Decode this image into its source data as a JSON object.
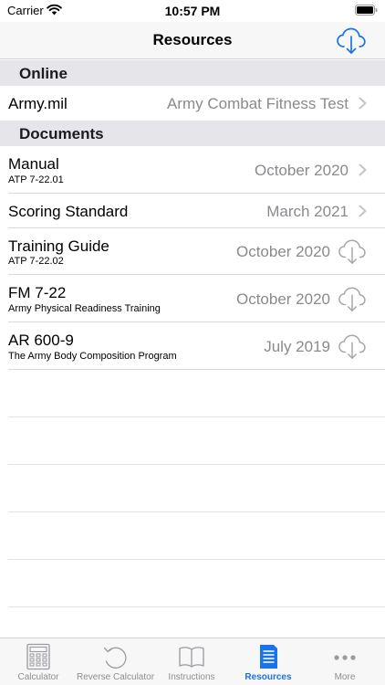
{
  "status": {
    "carrier": "Carrier",
    "time": "10:57 PM"
  },
  "nav": {
    "title": "Resources",
    "icon": "cloud-download-icon",
    "accent": "#1a73e8"
  },
  "sections": {
    "online": {
      "header": "Online",
      "rows": [
        {
          "title": "Army.mil",
          "value": "Army Combat Fitness Test",
          "accessory": "chevron"
        }
      ]
    },
    "documents": {
      "header": "Documents",
      "rows": [
        {
          "title": "Manual",
          "subtitle": "ATP 7-22.01",
          "value": "October 2020",
          "accessory": "chevron"
        },
        {
          "title": "Scoring Standard",
          "value": "March 2021",
          "accessory": "chevron"
        },
        {
          "title": "Training Guide",
          "subtitle": "ATP 7-22.02",
          "value": "October 2020",
          "accessory": "cloud-download"
        },
        {
          "title": "FM 7-22",
          "subtitle": "Army Physical Readiness Training",
          "value": "October 2020",
          "accessory": "cloud-download"
        },
        {
          "title": "AR 600-9",
          "subtitle": "The Army Body Composition Program",
          "value": "July 2019",
          "accessory": "cloud-download"
        }
      ]
    }
  },
  "tabs": [
    {
      "label": "Calculator",
      "icon": "calculator-icon"
    },
    {
      "label": "Reverse Calculator",
      "icon": "reverse-arrow-icon"
    },
    {
      "label": "Instructions",
      "icon": "book-icon"
    },
    {
      "label": "Resources",
      "icon": "document-icon",
      "active": true
    },
    {
      "label": "More",
      "icon": "more-dots-icon"
    }
  ]
}
